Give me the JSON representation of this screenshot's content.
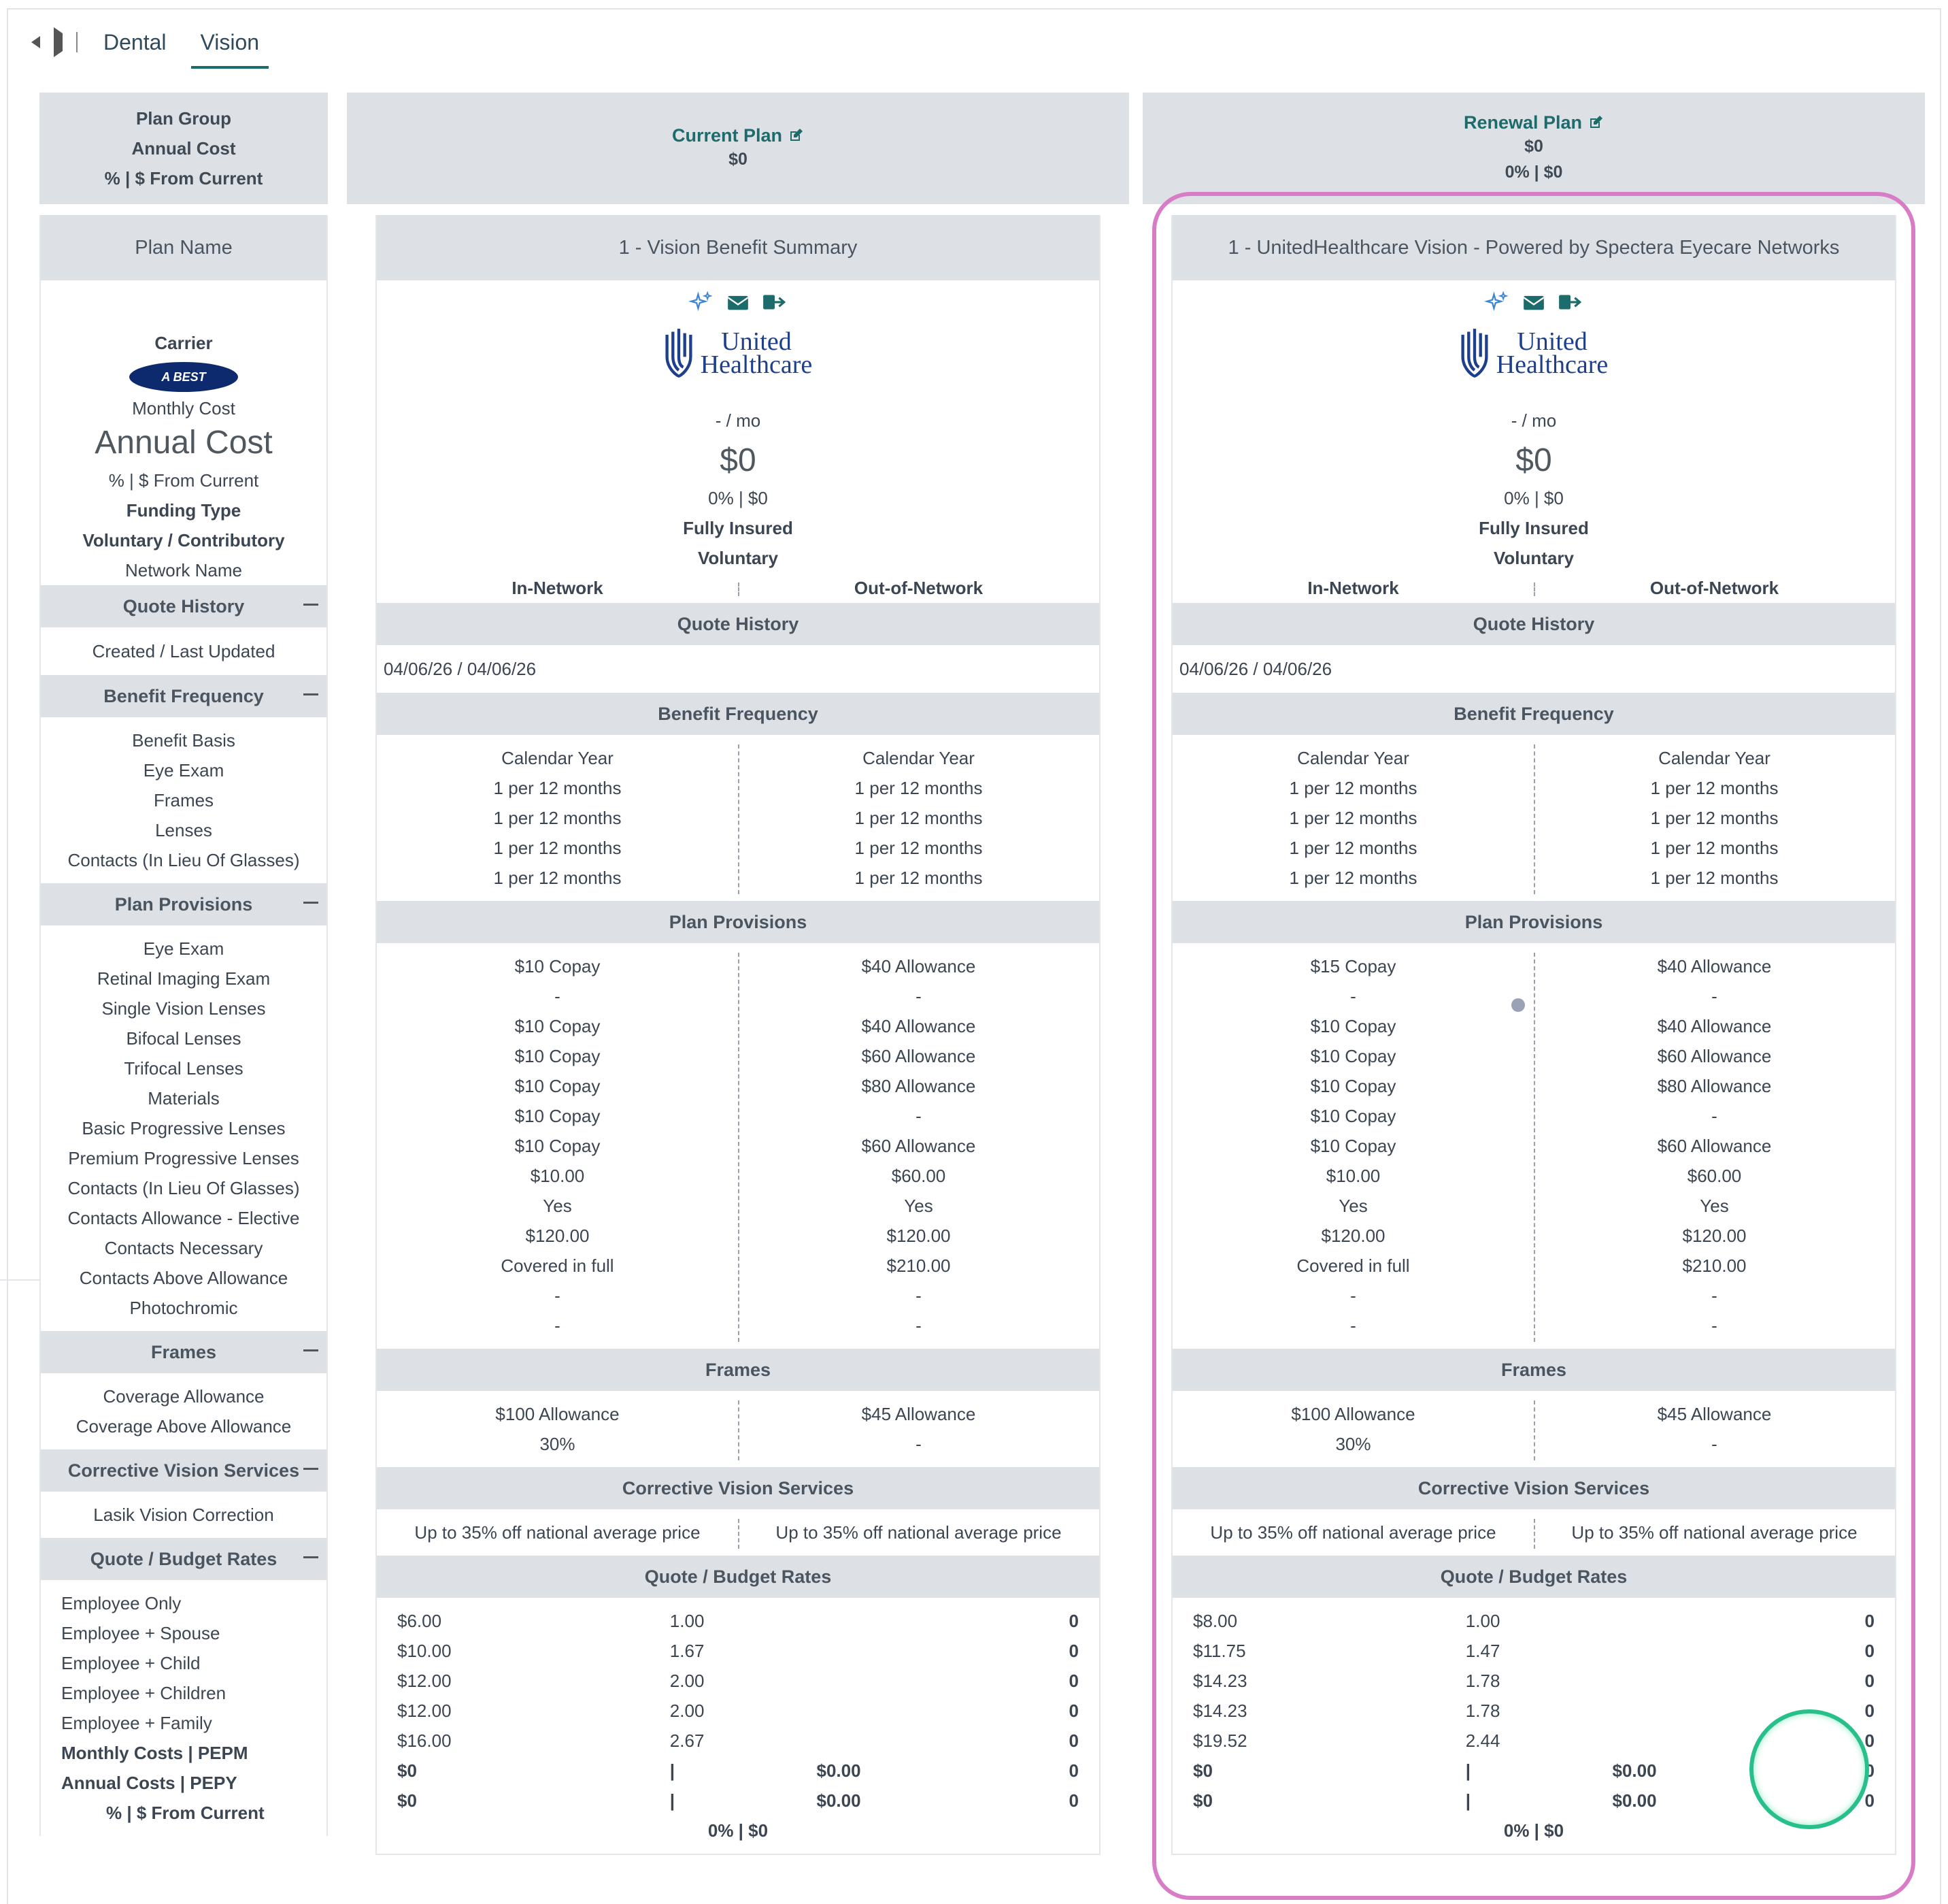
{
  "tabs": [
    "Dental",
    "Vision"
  ],
  "active_tab": "Vision",
  "labels": {
    "group_header": [
      "Plan Group",
      "Annual Cost",
      "% | $ From Current"
    ],
    "plan_name": "Plan Name",
    "carrier": "Carrier",
    "best_logo": "A BEST",
    "monthly_cost": "Monthly Cost",
    "annual_cost": "Annual Cost",
    "from_current": "% | $ From Current",
    "funding_type": "Funding Type",
    "voluntary": "Voluntary / Contributory",
    "network_name": "Network Name",
    "quote_history": "Quote History",
    "created": "Created / Last Updated",
    "benefit_frequency": "Benefit Frequency",
    "bf_items": [
      "Benefit Basis",
      "Eye Exam",
      "Frames",
      "Lenses",
      "Contacts (In Lieu Of Glasses)"
    ],
    "plan_provisions": "Plan Provisions",
    "pp_items": [
      "Eye Exam",
      "Retinal Imaging Exam",
      "Single Vision Lenses",
      "Bifocal Lenses",
      "Trifocal Lenses",
      "Materials",
      "Basic Progressive Lenses",
      "Premium Progressive Lenses",
      "Contacts (In Lieu Of Glasses)",
      "Contacts Allowance - Elective",
      "Contacts Necessary",
      "Contacts Above Allowance",
      "Photochromic"
    ],
    "frames": "Frames",
    "fr_items": [
      "Coverage Allowance",
      "Coverage Above Allowance"
    ],
    "corrective": "Corrective Vision Services",
    "cv_items": [
      "Lasik Vision Correction"
    ],
    "rates": "Quote / Budget Rates",
    "rate_items": [
      "Employee Only",
      "Employee + Spouse",
      "Employee + Child",
      "Employee + Children",
      "Employee + Family"
    ],
    "rate_totals": [
      "Monthly Costs | PEPM",
      "Annual Costs | PEPY",
      "% | $ From Current"
    ]
  },
  "current": {
    "title": "Current Plan",
    "cost": "$0",
    "change": "",
    "plan_name": "1 - Vision Benefit Summary",
    "carrier_logo": [
      "United",
      "Healthcare"
    ],
    "per_mo": "- / mo",
    "annual": "$0",
    "from_current": "0% | $0",
    "funding": "Fully Insured",
    "voluntary": "Voluntary",
    "in_net": "In-Network",
    "out_net": "Out-of-Network",
    "date": "04/06/26 / 04/06/26",
    "bf_in": [
      "Calendar Year",
      "1 per 12 months",
      "1 per 12 months",
      "1 per 12 months",
      "1 per 12 months"
    ],
    "bf_out": [
      "Calendar Year",
      "1 per 12 months",
      "1 per 12 months",
      "1 per 12 months",
      "1 per 12 months"
    ],
    "pp_in": [
      "$10 Copay",
      "-",
      "$10 Copay",
      "$10 Copay",
      "$10 Copay",
      "$10 Copay",
      "$10 Copay",
      "$10.00",
      "Yes",
      "$120.00",
      "Covered in full",
      "-",
      "-"
    ],
    "pp_out": [
      "$40 Allowance",
      "-",
      "$40 Allowance",
      "$60 Allowance",
      "$80 Allowance",
      "-",
      "$60 Allowance",
      "$60.00",
      "Yes",
      "$120.00",
      "$210.00",
      "-",
      "-"
    ],
    "fr_in": [
      "$100 Allowance",
      "30%"
    ],
    "fr_out": [
      "$45 Allowance",
      "-"
    ],
    "cv_in": [
      "Up to 35% off national average price"
    ],
    "cv_out": [
      "Up to 35% off national average price"
    ],
    "rates": [
      [
        "$6.00",
        "1.00",
        "0"
      ],
      [
        "$10.00",
        "1.67",
        "0"
      ],
      [
        "$12.00",
        "2.00",
        "0"
      ],
      [
        "$12.00",
        "2.00",
        "0"
      ],
      [
        "$16.00",
        "2.67",
        "0"
      ]
    ],
    "totals": [
      [
        "$0",
        "$0.00",
        "0"
      ],
      [
        "$0",
        "$0.00",
        "0"
      ]
    ],
    "total_change": "0% | $0"
  },
  "renewal": {
    "title": "Renewal Plan",
    "cost": "$0",
    "change": "0% | $0",
    "plan_name": "1 - UnitedHealthcare Vision - Powered by Spectera Eyecare Networks",
    "carrier_logo": [
      "United",
      "Healthcare"
    ],
    "per_mo": "- / mo",
    "annual": "$0",
    "from_current": "0% | $0",
    "funding": "Fully Insured",
    "voluntary": "Voluntary",
    "in_net": "In-Network",
    "out_net": "Out-of-Network",
    "date": "04/06/26 / 04/06/26",
    "bf_in": [
      "Calendar Year",
      "1 per 12 months",
      "1 per 12 months",
      "1 per 12 months",
      "1 per 12 months"
    ],
    "bf_out": [
      "Calendar Year",
      "1 per 12 months",
      "1 per 12 months",
      "1 per 12 months",
      "1 per 12 months"
    ],
    "pp_in": [
      "$15 Copay",
      "-",
      "$10 Copay",
      "$10 Copay",
      "$10 Copay",
      "$10 Copay",
      "$10 Copay",
      "$10.00",
      "Yes",
      "$120.00",
      "Covered in full",
      "-",
      "-"
    ],
    "pp_out": [
      "$40 Allowance",
      "-",
      "$40 Allowance",
      "$60 Allowance",
      "$80 Allowance",
      "-",
      "$60 Allowance",
      "$60.00",
      "Yes",
      "$120.00",
      "$210.00",
      "-",
      "-"
    ],
    "fr_in": [
      "$100 Allowance",
      "30%"
    ],
    "fr_out": [
      "$45 Allowance",
      "-"
    ],
    "cv_in": [
      "Up to 35% off national average price"
    ],
    "cv_out": [
      "Up to 35% off national average price"
    ],
    "rates": [
      [
        "$8.00",
        "1.00",
        "0"
      ],
      [
        "$11.75",
        "1.47",
        "0"
      ],
      [
        "$14.23",
        "1.78",
        "0"
      ],
      [
        "$14.23",
        "1.78",
        "0"
      ],
      [
        "$19.52",
        "2.44",
        "0"
      ]
    ],
    "totals": [
      [
        "$0",
        "$0.00",
        "0"
      ],
      [
        "$0",
        "$0.00",
        "0"
      ]
    ],
    "total_change": "0% | $0"
  },
  "colors": {
    "accent": "#1e6b6b",
    "highlight": "#d97cc7",
    "ring": "#27c08a",
    "header_bg": "#dde1e6"
  }
}
